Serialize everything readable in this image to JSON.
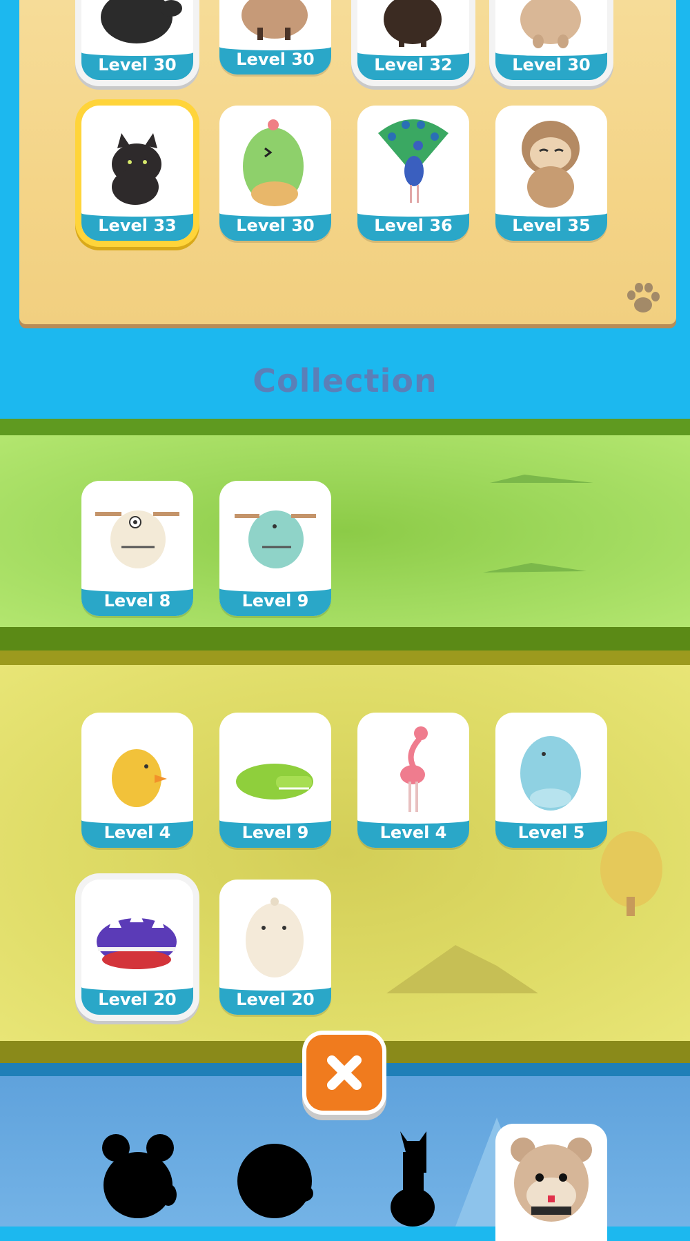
{
  "top_cards_row1": [
    {
      "level": "Level 30",
      "animal": "black-bear-icon"
    },
    {
      "level": "Level 30",
      "animal": "cow-icon"
    },
    {
      "level": "Level 32",
      "animal": "bison-icon"
    },
    {
      "level": "Level 30",
      "animal": "tan-creature-icon"
    }
  ],
  "top_cards_row2": [
    {
      "level": "Level 33",
      "animal": "black-cat-icon",
      "selected": true
    },
    {
      "level": "Level 30",
      "animal": "green-dino-icon"
    },
    {
      "level": "Level 36",
      "animal": "peacock-icon"
    },
    {
      "level": "Level 35",
      "animal": "sloth-icon"
    }
  ],
  "collection_title": "Collection",
  "green_cards": [
    {
      "level": "Level 8",
      "animal": "white-monster-icon"
    },
    {
      "level": "Level 9",
      "animal": "teal-monster-icon"
    }
  ],
  "yellow_cards_row1": [
    {
      "level": "Level 4",
      "animal": "chick-icon"
    },
    {
      "level": "Level 9",
      "animal": "crocodile-icon"
    },
    {
      "level": "Level 4",
      "animal": "flamingo-icon"
    },
    {
      "level": "Level 5",
      "animal": "blue-dino-icon"
    }
  ],
  "yellow_cards_row2": [
    {
      "level": "Level 20",
      "animal": "spiky-shell-icon"
    },
    {
      "level": "Level 20",
      "animal": "white-dino-icon"
    }
  ],
  "locked_animals": [
    "bear-silhouette-icon",
    "sheep-silhouette-icon",
    "llama-silhouette-icon"
  ],
  "unlocked_bottom": "hamster-icon",
  "colors": {
    "sky": "#1cb8ef",
    "card_band": "#2aa7c8",
    "close_button": "#f07b1e",
    "selected_frame": "#ffd43a"
  }
}
